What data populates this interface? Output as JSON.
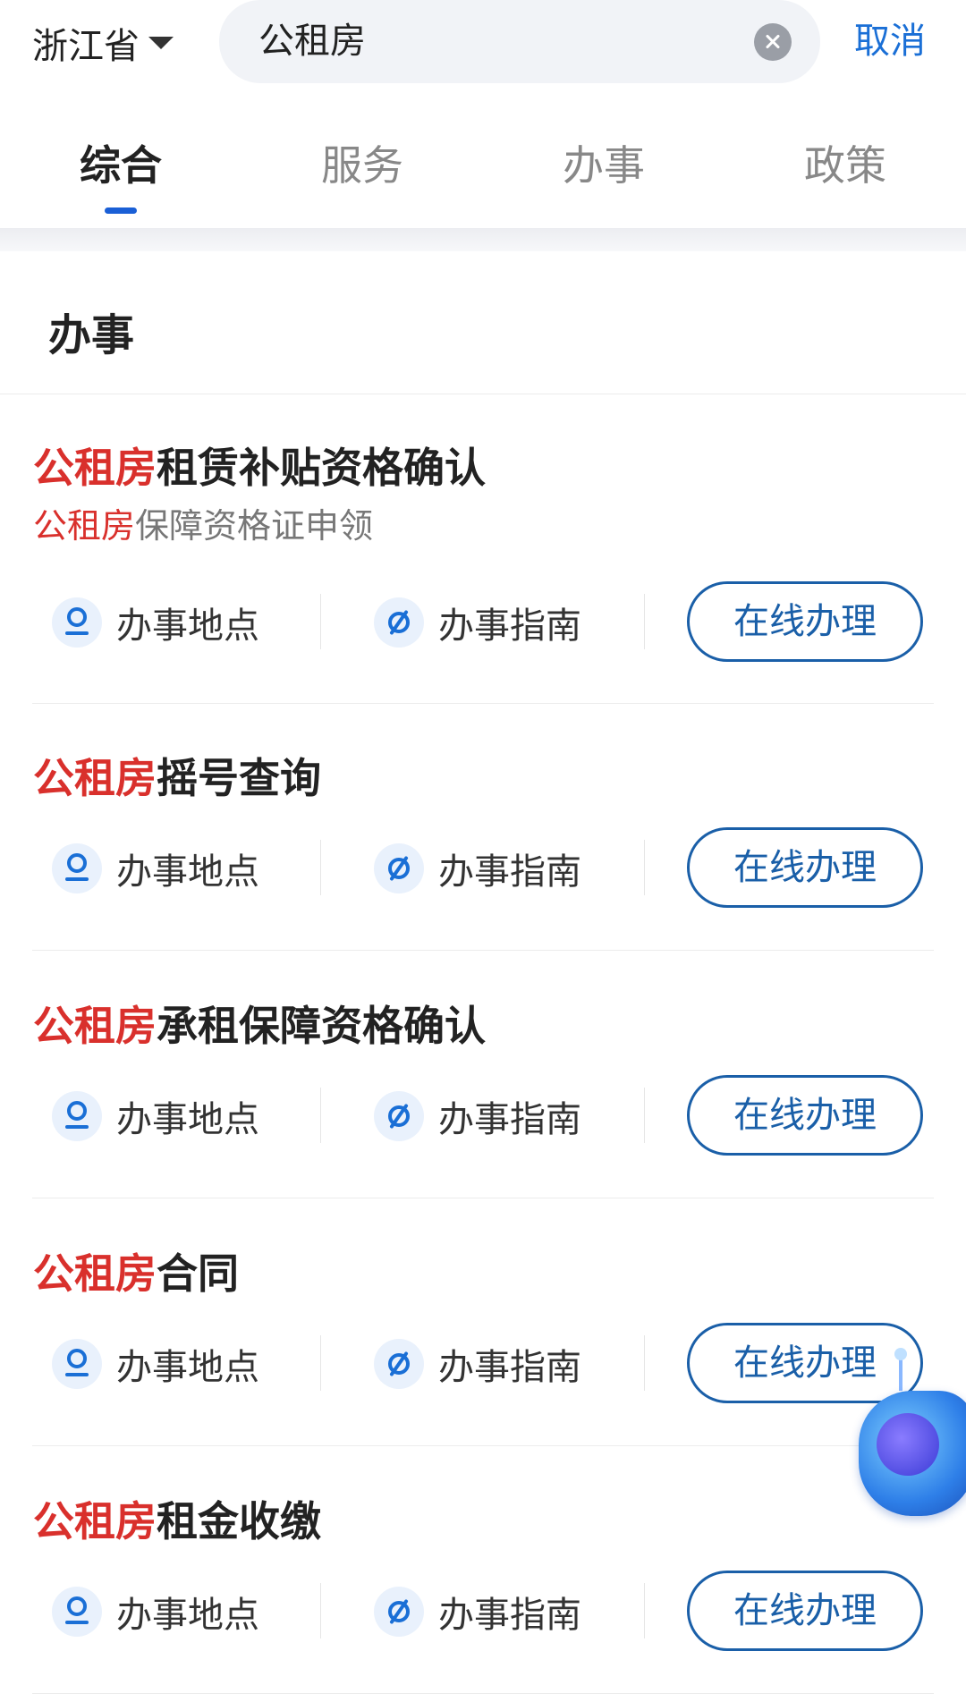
{
  "header": {
    "region": "浙江省",
    "search_value": "公租房",
    "cancel_label": "取消"
  },
  "tabs": [
    {
      "label": "综合",
      "active": true
    },
    {
      "label": "服务",
      "active": false
    },
    {
      "label": "办事",
      "active": false
    },
    {
      "label": "政策",
      "active": false
    }
  ],
  "section": {
    "title": "办事"
  },
  "actions": {
    "location_label": "办事地点",
    "guide_label": "办事指南",
    "online_label": "在线办理"
  },
  "items": [
    {
      "highlight": "公租房",
      "rest": "租赁补贴资格确认",
      "sub_highlight": "公租房",
      "sub_rest": "保障资格证申领"
    },
    {
      "highlight": "公租房",
      "rest": "摇号查询"
    },
    {
      "highlight": "公租房",
      "rest": "承租保障资格确认"
    },
    {
      "highlight": "公租房",
      "rest": "合同"
    },
    {
      "highlight": "公租房",
      "rest": "租金收缴"
    }
  ],
  "colors": {
    "accent": "#1a6fd6",
    "highlight": "#d9302c",
    "button_border": "#1a5fa8"
  }
}
